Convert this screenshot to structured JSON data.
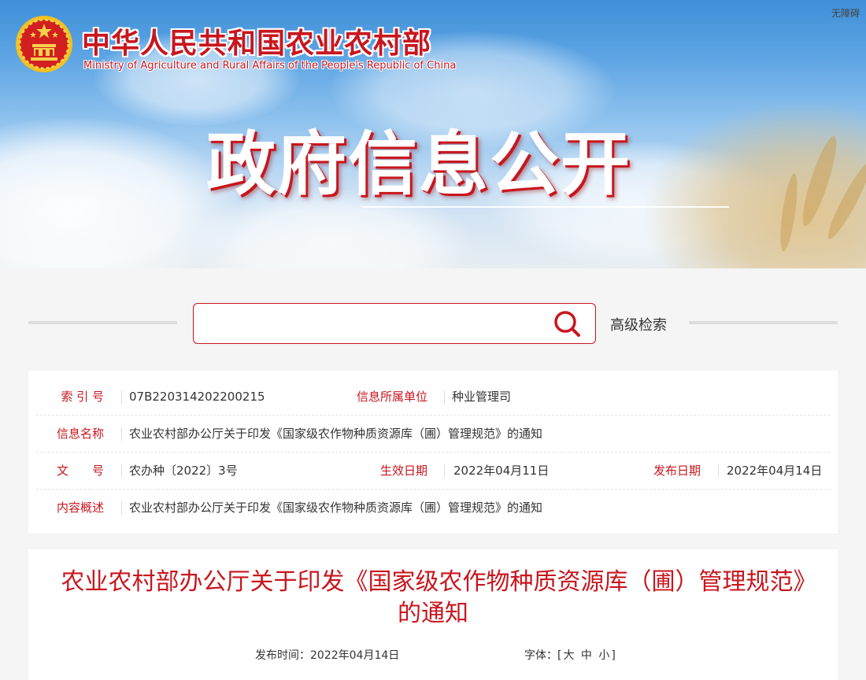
{
  "header": {
    "accessibility_label": "无障碍",
    "site_title": "中华人民共和国农业农村部",
    "site_subtitle": "Ministry of Agriculture and Rural Affairs of the People's Republic of China",
    "banner_title": "政府信息公开"
  },
  "search": {
    "placeholder": "",
    "advanced_label": "高级检索",
    "icon": "search-icon"
  },
  "info": {
    "index_label": "索 引 号",
    "index_value": "07B220314202200215",
    "unit_label": "信息所属单位",
    "unit_value": "种业管理司",
    "name_label": "信息名称",
    "name_value": "农业农村部办公厅关于印发《国家级农作物种质资源库（圃）管理规范》的通知",
    "doc_label": "文　　号",
    "doc_value": "农办种〔2022〕3号",
    "effective_label": "生效日期",
    "effective_value": "2022年04月11日",
    "publish_label": "发布日期",
    "publish_value": "2022年04月14日",
    "summary_label": "内容概述",
    "summary_value": "农业农村部办公厅关于印发《国家级农作物种质资源库（圃）管理规范》的通知"
  },
  "article": {
    "title": "农业农村部办公厅关于印发《国家级农作物种质资源库（圃）管理规范》的通知",
    "publish_time": "发布时间：2022年04月14日",
    "font_size_label": "字体：[",
    "font_large": "大",
    "font_medium": "中",
    "font_small": "小",
    "font_size_close": "]"
  },
  "colors": {
    "accent": "#c8161e",
    "label_red": "#c8161e"
  }
}
